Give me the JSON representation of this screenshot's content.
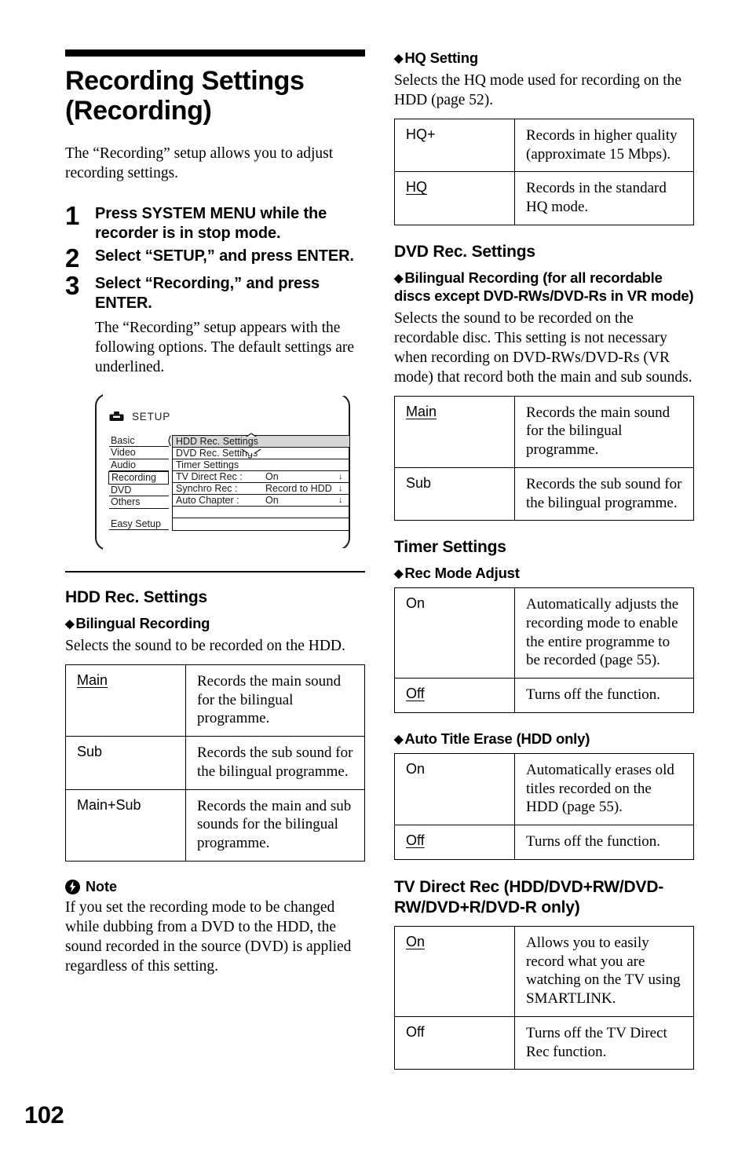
{
  "page_number": "102",
  "left_column": {
    "title": "Recording Settings (Recording)",
    "intro": "The “Recording” setup allows you to adjust recording settings.",
    "steps": [
      {
        "number": "1",
        "heading": "Press SYSTEM MENU while the recorder is in stop mode.",
        "sub": ""
      },
      {
        "number": "2",
        "heading": "Select “SETUP,” and press ENTER.",
        "sub": ""
      },
      {
        "number": "3",
        "heading": "Select “Recording,” and press ENTER.",
        "sub": "The “Recording” setup appears with the following options. The default settings are underlined."
      }
    ],
    "illustration": {
      "icon_name": "toolbox-icon",
      "screen_title": "SETUP",
      "left_menu": [
        "Basic",
        "Video",
        "Audio",
        "Recording",
        "DVD",
        "Others"
      ],
      "left_menu_selected": "Recording",
      "left_menu_footer": "Easy Setup",
      "right_rows": [
        {
          "name": "HDD Rec. Settings",
          "value": "",
          "arrow": "",
          "highlight": true
        },
        {
          "name": "DVD Rec. Settings",
          "value": "",
          "arrow": "",
          "highlight": false
        },
        {
          "name": "Timer Settings",
          "value": "",
          "arrow": "",
          "highlight": false
        },
        {
          "name": "TV Direct Rec :",
          "value": "On",
          "arrow": "↓",
          "highlight": false
        },
        {
          "name": "Synchro Rec :",
          "value": "Record to HDD",
          "arrow": "↓",
          "highlight": false
        },
        {
          "name": "Auto Chapter :",
          "value": "On",
          "arrow": "↓",
          "highlight": false
        },
        {
          "name": "",
          "value": "",
          "arrow": "",
          "highlight": false
        },
        {
          "name": "",
          "value": "",
          "arrow": "",
          "highlight": false
        }
      ]
    },
    "hdd_rec_settings": {
      "heading": "HDD Rec. Settings",
      "subheading": "Bilingual Recording",
      "lead": "Selects the sound to be recorded on the HDD.",
      "rows": [
        {
          "key": "Main",
          "underlined": true,
          "value": "Records the main sound for the bilingual programme."
        },
        {
          "key": "Sub",
          "underlined": false,
          "value": "Records the sub sound for the bilingual programme."
        },
        {
          "key": "Main+Sub",
          "underlined": false,
          "value": "Records the main and sub sounds for the bilingual programme."
        }
      ]
    },
    "note": {
      "icon_name": "note-bolt-icon",
      "label": "Note",
      "text": "If you set the recording mode to be changed while dubbing from a DVD to the HDD, the sound recorded in the source (DVD) is applied regardless of this setting."
    }
  },
  "right_column": {
    "hq_setting": {
      "subheading": "HQ Setting",
      "lead": "Selects the HQ mode used for recording on the HDD (page 52).",
      "rows": [
        {
          "key": "HQ+",
          "underlined": false,
          "value": "Records in higher quality (approximate 15 Mbps)."
        },
        {
          "key": "HQ",
          "underlined": true,
          "value": "Records in the standard HQ mode."
        }
      ]
    },
    "dvd_rec_settings": {
      "heading": "DVD Rec. Settings",
      "subheading": "Bilingual Recording (for all recordable discs except DVD-RWs/DVD-Rs in VR mode)",
      "lead": "Selects the sound to be recorded on the recordable disc. This setting is not necessary when recording on DVD-RWs/DVD-Rs (VR mode) that record both the main and sub sounds.",
      "rows": [
        {
          "key": "Main",
          "underlined": true,
          "value": "Records the main sound for the bilingual programme."
        },
        {
          "key": "Sub",
          "underlined": false,
          "value": "Records the sub sound for the bilingual programme."
        }
      ]
    },
    "timer_settings": {
      "heading": "Timer Settings",
      "rec_mode_adjust": {
        "subheading": "Rec Mode Adjust",
        "rows": [
          {
            "key": "On",
            "underlined": false,
            "value": "Automatically adjusts the recording mode to enable the entire programme to be recorded (page 55)."
          },
          {
            "key": "Off",
            "underlined": true,
            "value": "Turns off the function."
          }
        ]
      },
      "auto_title_erase": {
        "subheading": "Auto Title Erase (HDD only)",
        "rows": [
          {
            "key": "On",
            "underlined": false,
            "value": "Automatically erases old titles recorded on the HDD (page 55)."
          },
          {
            "key": "Off",
            "underlined": true,
            "value": "Turns off the function."
          }
        ]
      }
    },
    "tv_direct_rec": {
      "heading": "TV Direct Rec (HDD/DVD+RW/DVD-RW/DVD+R/DVD-R only)",
      "rows": [
        {
          "key": "On",
          "underlined": true,
          "value": "Allows you to easily record what you are watching on the TV using SMARTLINK."
        },
        {
          "key": "Off",
          "underlined": false,
          "value": "Turns off the TV Direct Rec function."
        }
      ]
    }
  }
}
